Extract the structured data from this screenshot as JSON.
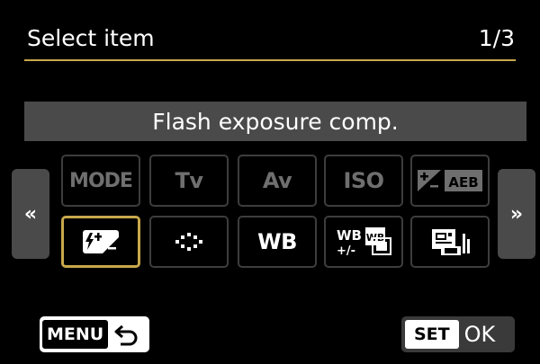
{
  "header": {
    "title": "Select item",
    "page_indicator": "1/3"
  },
  "current_item_label": "Flash exposure comp.",
  "navigation": {
    "prev_glyph": "«",
    "next_glyph": "»",
    "prev_icon": "double-chevron-left-icon",
    "next_icon": "double-chevron-right-icon"
  },
  "grid": {
    "rows": [
      [
        {
          "id": "mode",
          "type": "text",
          "text": "MODE",
          "enabled": false,
          "selected": false
        },
        {
          "id": "tv",
          "type": "text",
          "text": "Tv",
          "enabled": false,
          "selected": false
        },
        {
          "id": "av",
          "type": "text",
          "text": "Av",
          "enabled": false,
          "selected": false
        },
        {
          "id": "iso",
          "type": "text",
          "text": "ISO",
          "enabled": false,
          "selected": false
        },
        {
          "id": "exposure-comp-aeb",
          "type": "icon",
          "icon": "exposure-comp-aeb-icon",
          "badge": "AEB",
          "enabled": false,
          "selected": false
        }
      ],
      [
        {
          "id": "flash-exposure-comp",
          "type": "icon",
          "icon": "flash-exposure-comp-icon",
          "enabled": true,
          "selected": true
        },
        {
          "id": "picture-style",
          "type": "icon",
          "icon": "picture-style-icon",
          "enabled": true,
          "selected": false
        },
        {
          "id": "wb",
          "type": "text",
          "text": "WB",
          "enabled": true,
          "selected": false
        },
        {
          "id": "wb-shift-bkt",
          "type": "icon",
          "icon": "wb-shift-bracket-icon",
          "text_top": "WB",
          "text_bottom": "+/-",
          "badge": "WB",
          "enabled": true,
          "selected": false
        },
        {
          "id": "custom-wb",
          "type": "icon",
          "icon": "custom-white-balance-icon",
          "enabled": true,
          "selected": false
        }
      ]
    ]
  },
  "footer": {
    "menu_label": "MENU",
    "menu_icon": "back-arrow-icon",
    "set_label": "SET",
    "ok_label": "OK"
  },
  "colors": {
    "accent": "#c8a84b",
    "label_bar": "#4a4a4a",
    "disabled_text": "#6f6f6f",
    "tile_border": "#3d3d3d"
  }
}
